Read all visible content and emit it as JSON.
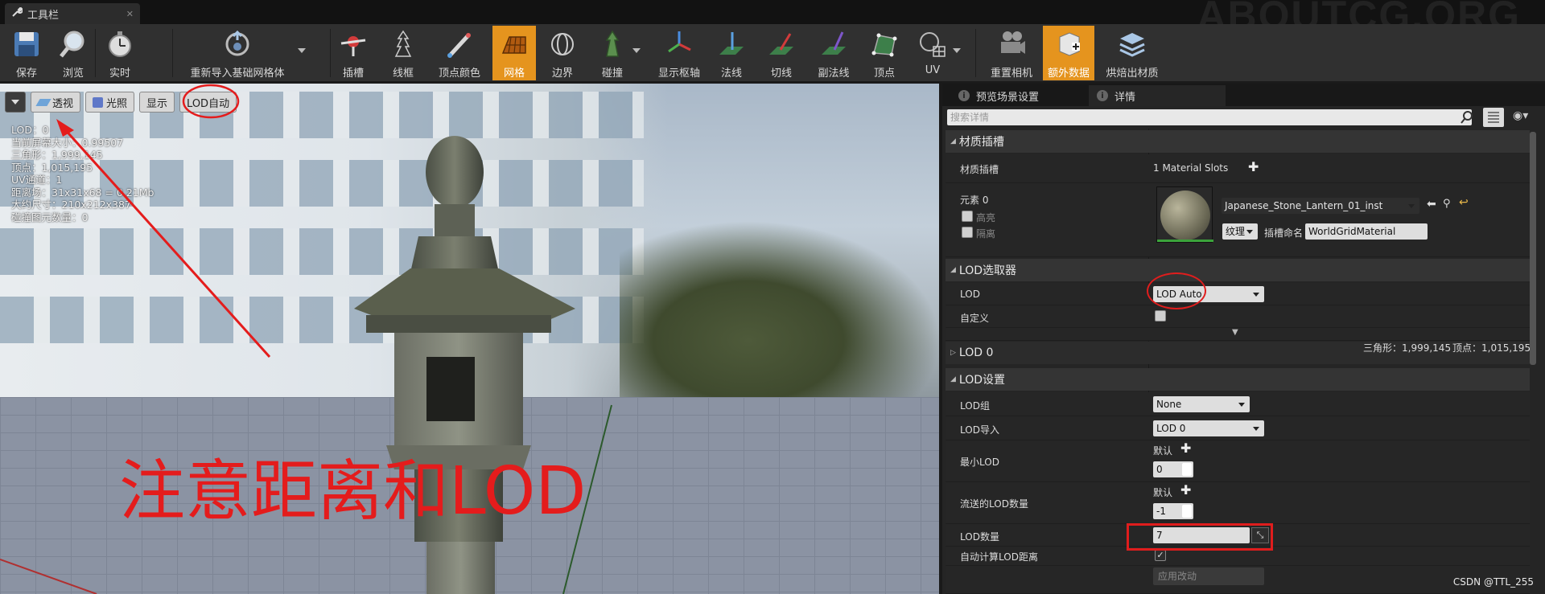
{
  "window": {
    "tab_title": "工具栏",
    "watermark": "ABOUTCG.ORG"
  },
  "toolbar": {
    "buttons": [
      {
        "id": "save",
        "label": "保存",
        "icon": "save-icon"
      },
      {
        "id": "browse",
        "label": "浏览",
        "icon": "magnifier-icon"
      },
      {
        "id": "realtime",
        "label": "实时",
        "icon": "stopwatch-icon"
      },
      {
        "id": "reimport",
        "label": "重新导入基础网格体",
        "icon": "reimport-icon"
      },
      {
        "id": "socket",
        "label": "插槽",
        "icon": "socket-icon"
      },
      {
        "id": "wireframe",
        "label": "线框",
        "icon": "wireframe-icon"
      },
      {
        "id": "vertex_color",
        "label": "顶点颜色",
        "icon": "paint-brush-icon"
      },
      {
        "id": "grid",
        "label": "网格",
        "icon": "grid-icon",
        "active": true
      },
      {
        "id": "bounds",
        "label": "边界",
        "icon": "bounds-icon"
      },
      {
        "id": "collision",
        "label": "碰撞",
        "icon": "collision-icon"
      },
      {
        "id": "pivot",
        "label": "显示枢轴",
        "icon": "pivot-icon"
      },
      {
        "id": "normals",
        "label": "法线",
        "icon": "normals-icon"
      },
      {
        "id": "tangents",
        "label": "切线",
        "icon": "tangents-icon"
      },
      {
        "id": "binormals",
        "label": "副法线",
        "icon": "binormals-icon"
      },
      {
        "id": "vertices",
        "label": "顶点",
        "icon": "vertices-icon"
      },
      {
        "id": "uv",
        "label": "UV",
        "icon": "uv-icon"
      },
      {
        "id": "reset_camera",
        "label": "重置相机",
        "icon": "camera-icon"
      },
      {
        "id": "additional_data",
        "label": "额外数据",
        "icon": "data-icon",
        "active": true
      },
      {
        "id": "bake_material",
        "label": "烘焙出材质",
        "icon": "layers-icon"
      }
    ]
  },
  "viewport": {
    "buttons": {
      "perspective": "透视",
      "lit": "光照",
      "show": "显示",
      "lod": "LOD自动"
    },
    "stats": [
      "LOD：0",
      "当前屏幕大小：0.99507",
      "三角形：1,999,145",
      "顶点：1,015,195",
      "UV通道：1",
      "距离场：31x31x68 = 0.21Mb",
      "大约尺寸：210x212x387",
      "碰撞图元数量：0"
    ],
    "annotation": "注意距离和LOD"
  },
  "details": {
    "tabs": {
      "preview": "预览场景设置",
      "details": "详情"
    },
    "search_placeholder": "搜索详情",
    "material_slots": {
      "section": "材质插槽",
      "label": "材质插槽",
      "value": "1 Material Slots",
      "element": "元素 0",
      "highlight": "高亮",
      "isolate": "隔离",
      "material_name": "Japanese_Stone_Lantern_01_inst",
      "texture_btn": "纹理",
      "slot_name_label": "插槽命名",
      "slot_name": "WorldGridMaterial"
    },
    "lod_picker": {
      "section": "LOD选取器",
      "lod_label": "LOD",
      "lod_value": "LOD Auto",
      "custom_label": "自定义"
    },
    "lod0": {
      "section": "LOD 0",
      "triangles": "三角形：1,999,145",
      "vertices": "顶点：1,015,195"
    },
    "lod_settings": {
      "section": "LOD设置",
      "group_label": "LOD组",
      "group_value": "None",
      "import_label": "LOD导入",
      "import_value": "LOD 0",
      "min_lod_label": "最小LOD",
      "default_label": "默认",
      "min_lod_value": "0",
      "streamed_label": "流送的LOD数量",
      "streamed_value": "-1",
      "count_label": "LOD数量",
      "count_value": "7",
      "auto_label": "自动计算LOD距离",
      "auto_checked": true,
      "apply_btn": "应用改动"
    }
  },
  "credit": "CSDN @TTL_255"
}
